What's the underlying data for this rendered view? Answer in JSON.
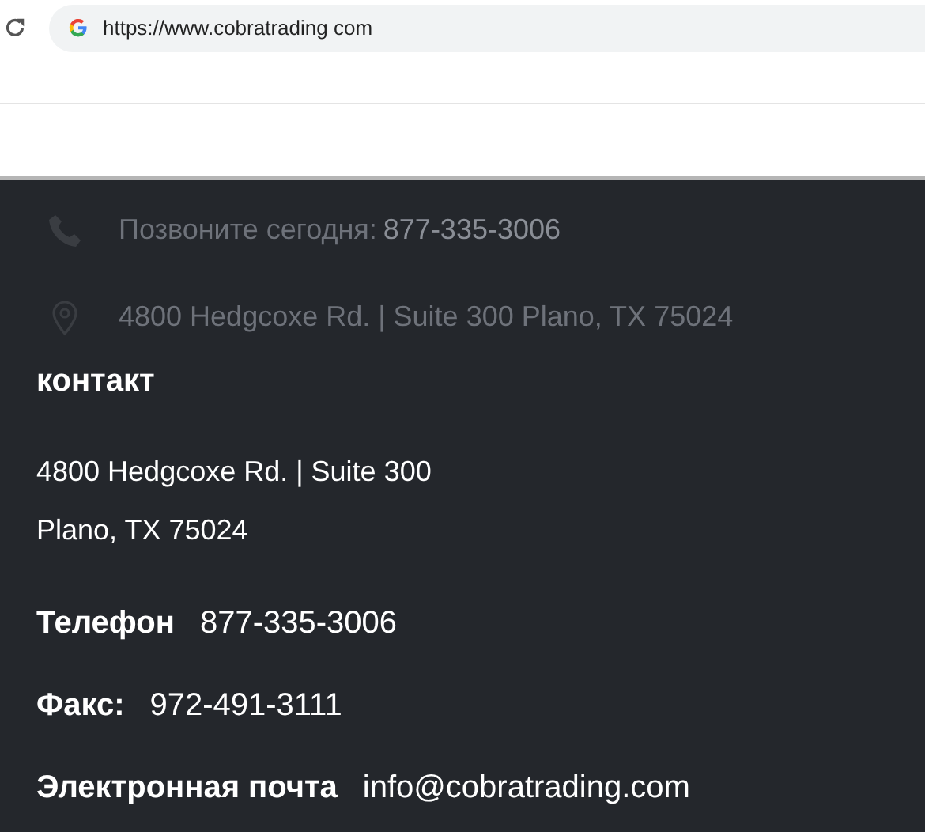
{
  "browser": {
    "url": "https://www.cobratrading com"
  },
  "top_contacts": [
    {
      "kind": "phone",
      "label": "Позвоните сегодня:",
      "value": "877-335-3006"
    },
    {
      "kind": "address",
      "label": "4800 Hedgcoxe Rd. | Suite 300 Plano, TX 75024"
    }
  ],
  "contact": {
    "heading": "контакт",
    "address_lines": [
      "4800 Hedgcoxe Rd. | Suite 300",
      "Plano, TX 75024"
    ],
    "items": [
      {
        "label": "Телефон",
        "value": "877-335-3006"
      },
      {
        "label": "Факс:",
        "value": "972-491-3111"
      },
      {
        "label": "Электронная почта",
        "value": "info@cobratrading.com"
      }
    ]
  }
}
